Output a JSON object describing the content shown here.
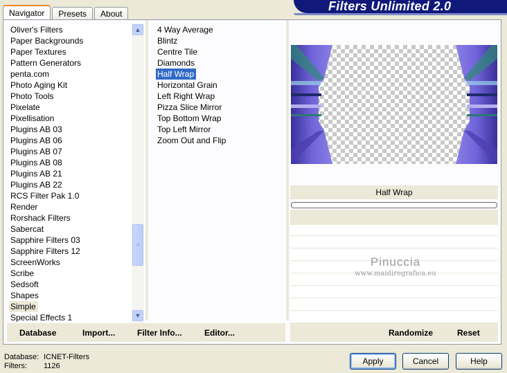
{
  "tabs": [
    "Navigator",
    "Presets",
    "About"
  ],
  "app_title": "Filters Unlimited 2.0",
  "categories": [
    "Oliver's Filters",
    "Paper Backgrounds",
    "Paper Textures",
    "Pattern Generators",
    "penta.com",
    "Photo Aging Kit",
    "Photo Tools",
    "Pixelate",
    "Pixellisation",
    "Plugins AB 03",
    "Plugins AB 06",
    "Plugins AB 07",
    "Plugins AB 08",
    "Plugins AB 21",
    "Plugins AB 22",
    "RCS Filter Pak 1.0",
    "Render",
    "Rorshack Filters",
    "Sabercat",
    "Sapphire Filters 03",
    "Sapphire Filters 12",
    "ScreenWorks",
    "Scribe",
    "Sedsoft",
    "Shapes",
    "Simple",
    "Special Effects 1"
  ],
  "selected_category": "Simple",
  "filters": [
    "4 Way Average",
    "Blintz",
    "Centre Tile",
    "Diamonds",
    "Half Wrap",
    "Horizontal Grain",
    "Left Right Wrap",
    "Pizza Slice Mirror",
    "Top Bottom Wrap",
    "Top Left Mirror",
    "Zoom Out and Flip"
  ],
  "selected_filter": "Half Wrap",
  "filter_name_display": "Half Wrap",
  "progress": 0,
  "watermark": {
    "line1": "Pinuccia",
    "line2": "www.maidiregrafica.eu"
  },
  "toolbar": {
    "database": "Database",
    "import": "Import...",
    "filter_info": "Filter Info...",
    "editor": "Editor...",
    "randomize": "Randomize",
    "reset": "Reset"
  },
  "info": {
    "database_label": "Database:",
    "database_value": "ICNET-Filters",
    "filters_label": "Filters:",
    "filters_value": "1126"
  },
  "buttons": {
    "apply": "Apply",
    "cancel": "Cancel",
    "help": "Help"
  },
  "colors": {
    "selection": "#316ac5",
    "title_bar": "#10187a",
    "preview_purple": "#5b4fc2"
  }
}
